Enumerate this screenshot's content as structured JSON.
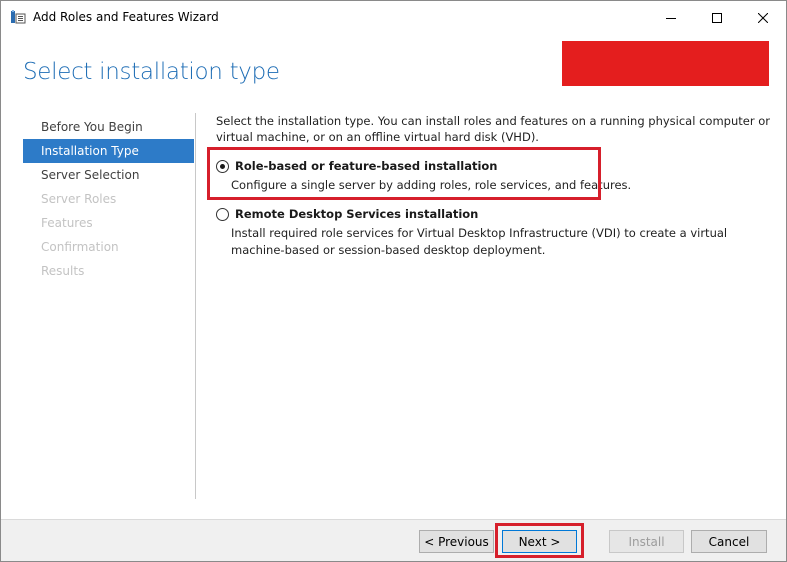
{
  "window": {
    "title": "Add Roles and Features Wizard",
    "icon": "server-manager-icon",
    "controls": [
      "minimize-icon",
      "maximize-icon",
      "close-icon"
    ]
  },
  "header": {
    "title": "Select installation type",
    "destination_redacted": true
  },
  "sidebar": {
    "items": [
      {
        "label": "Before You Begin",
        "state": "enabled"
      },
      {
        "label": "Installation Type",
        "state": "active"
      },
      {
        "label": "Server Selection",
        "state": "enabled"
      },
      {
        "label": "Server Roles",
        "state": "disabled"
      },
      {
        "label": "Features",
        "state": "disabled"
      },
      {
        "label": "Confirmation",
        "state": "disabled"
      },
      {
        "label": "Results",
        "state": "disabled"
      }
    ]
  },
  "content": {
    "intro": "Select the installation type. You can install roles and features on a running physical computer or virtual machine, or on an offline virtual hard disk (VHD).",
    "options": [
      {
        "label": "Role-based or feature-based installation",
        "description": "Configure a single server by adding roles, role services, and features.",
        "selected": true
      },
      {
        "label": "Remote Desktop Services installation",
        "description": "Install required role services for Virtual Desktop Infrastructure (VDI) to create a virtual machine-based or session-based desktop deployment.",
        "selected": false
      }
    ]
  },
  "footer": {
    "previous_label": "< Previous",
    "next_label": "Next >",
    "install_label": "Install",
    "cancel_label": "Cancel",
    "install_enabled": false
  },
  "colors": {
    "header_title": "#1e6db5",
    "sidebar_active": "#2d7bc8",
    "highlight": "#d61f2b",
    "redaction": "#e41e1e"
  }
}
